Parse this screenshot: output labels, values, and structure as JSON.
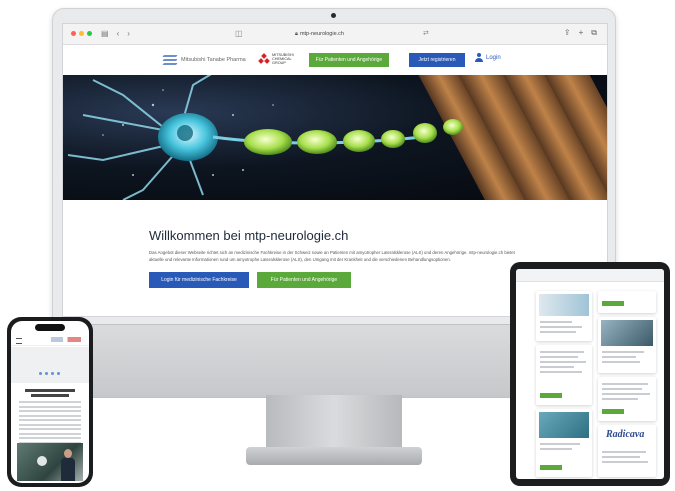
{
  "browser": {
    "url": "mtp-neurologie.ch",
    "lock_icon": "lock-icon",
    "translate_icon": "translate-icon"
  },
  "site": {
    "brand_name": "Mitsubishi Tanabe Pharma",
    "group_logo_text": "MITSUBISHI CHEMICAL GROUP",
    "nav": {
      "patients_button": "Für Patienten und Angehörige",
      "register_button": "Jetzt registrieren",
      "login_link": "Login"
    }
  },
  "welcome": {
    "title": "Willkommen bei mtp-neurologie.ch",
    "body": "Das Angebot dieser Webseite richtet sich an medizinische Fachkreise in der Schweiz sowie an Patienten mit amyotropher Lateralsklerose (ALS) und deren Angehörige. mtp-neurologie.ch bietet aktuelle und relevante Informationen rund um amyotrophe Lateralsklerose (ALS), den Umgang mit der Krankheit und die verschiedenen Behandlungsoptionen.",
    "login_professionals_button": "Login für medizinische Fachkreise",
    "patients_button": "Für Patienten und Angehörige"
  },
  "tablet": {
    "radicava_logo": "Radicava"
  },
  "colors": {
    "brand_blue": "#2a5ab8",
    "brand_green": "#5aa93a",
    "heading": "#1f2a3a"
  }
}
